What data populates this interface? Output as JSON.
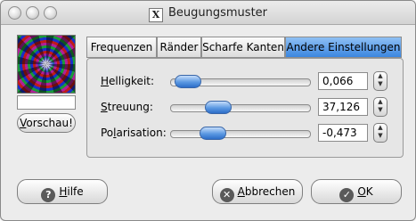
{
  "window": {
    "title": "Beugungsmuster",
    "title_icon_glyph": "X",
    "title_icon": "x11-app-icon",
    "traffic_lights": [
      "close-button",
      "minimize-button",
      "zoom-button"
    ]
  },
  "preview": {
    "image_name": "diffraction-pattern-preview",
    "progress_percent": 0,
    "button_mnemonic": "V",
    "button_rest": "orschau!"
  },
  "tabs": [
    {
      "label": "Frequenzen",
      "active": false
    },
    {
      "label": "Ränder",
      "active": false
    },
    {
      "label": "Scharfe Kanten",
      "active": false
    },
    {
      "label": "Andere Einstellungen",
      "active": true
    }
  ],
  "settings": {
    "brightness": {
      "mnemonic": "H",
      "rest": "elligkeit:",
      "value": "0,066",
      "slider_fraction": 0.12
    },
    "scattering": {
      "mnemonic": "S",
      "rest": "treuung:",
      "value": "37,126",
      "slider_fraction": 0.34
    },
    "polarization": {
      "pre": "Po",
      "mnemonic": "l",
      "rest": "arisation:",
      "value": "-0,473",
      "slider_fraction": 0.3
    }
  },
  "buttons": {
    "help": {
      "icon_glyph": "?",
      "mnemonic": "H",
      "rest": "ilfe"
    },
    "cancel": {
      "icon_glyph": "✕",
      "mnemonic": "A",
      "rest": "bbrechen"
    },
    "ok": {
      "icon_glyph": "✓",
      "mnemonic": "O",
      "rest": "K"
    }
  },
  "colors": {
    "accent": "#3b86e0",
    "window_bg": "#ececec"
  }
}
